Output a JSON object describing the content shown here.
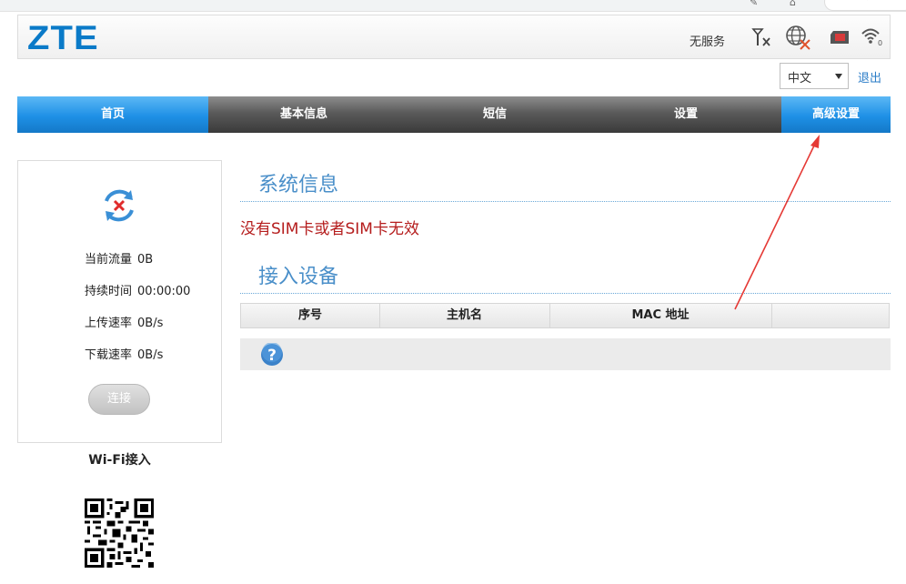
{
  "header": {
    "logo": "ZTE",
    "status_text": "无服务",
    "signal_icon_text": "Tx"
  },
  "language": {
    "selected": "中文"
  },
  "logout_label": "退出",
  "nav": {
    "items": [
      {
        "label": "首页"
      },
      {
        "label": "基本信息"
      },
      {
        "label": "短信"
      },
      {
        "label": "设置"
      },
      {
        "label": "高级设置"
      }
    ]
  },
  "connection": {
    "traffic_label": "当前流量",
    "traffic_value": "0B",
    "duration_label": "持续时间",
    "duration_value": "00:00:00",
    "upload_label": "上传速率",
    "upload_value": "0B/s",
    "download_label": "下载速率",
    "download_value": "0B/s",
    "connect_button": "连接"
  },
  "wifi": {
    "label": "Wi-Fi接入"
  },
  "system_info": {
    "title": "系统信息",
    "message": "没有SIM卡或者SIM卡无效"
  },
  "devices": {
    "title": "接入设备",
    "columns": [
      "序号",
      "主机名",
      "MAC 地址",
      ""
    ]
  },
  "colors": {
    "accent": "#1e90e6",
    "nav_dark": "#4a4a4a",
    "error": "#b51d1d",
    "title_blue": "#4a8fc9",
    "annotation_arrow": "#e53935"
  }
}
